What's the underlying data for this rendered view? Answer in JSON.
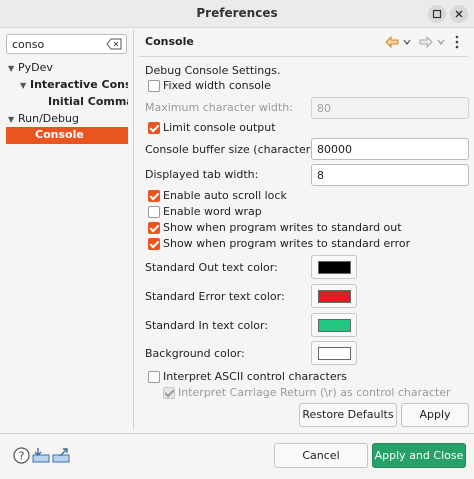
{
  "window": {
    "title": "Preferences"
  },
  "filter": {
    "value": "conso"
  },
  "tree": [
    {
      "label": "PyDev",
      "expanded": true
    },
    {
      "label": "Interactive Conso",
      "expanded": true
    },
    {
      "label": "Initial Comman"
    },
    {
      "label": "Run/Debug",
      "expanded": true
    },
    {
      "label": "Console",
      "selected": true
    }
  ],
  "page": {
    "title": "Console",
    "intro": "Debug Console Settings.",
    "fixed_width": {
      "label": "Fixed width console",
      "checked": false
    },
    "max_char_width": {
      "label": "Maximum character width:",
      "value": "80",
      "enabled": false
    },
    "limit_output": {
      "label": "Limit console output",
      "checked": true
    },
    "buffer_size": {
      "label": "Console buffer size (characters):",
      "value": "80000"
    },
    "tab_width": {
      "label": "Displayed tab width:",
      "value": "8"
    },
    "auto_scroll": {
      "label": "Enable auto scroll lock",
      "checked": true
    },
    "word_wrap": {
      "label": "Enable word wrap",
      "checked": false
    },
    "show_stdout": {
      "label": "Show when program writes to standard out",
      "checked": true
    },
    "show_stderr": {
      "label": "Show when program writes to standard error",
      "checked": true
    },
    "colors": [
      {
        "label": "Standard Out text color:",
        "color": "#000000"
      },
      {
        "label": "Standard Error text color:",
        "color": "#e01b24"
      },
      {
        "label": "Standard In text color:",
        "color": "#1fc77f"
      },
      {
        "label": "Background color:",
        "color": "#ffffff"
      }
    ],
    "interpret_ascii": {
      "label": "Interpret ASCII control characters",
      "checked": false
    },
    "interpret_cr": {
      "label": "Interpret Carriage Return (\\r) as control character",
      "checked": true,
      "enabled": false
    },
    "restore_defaults": "Restore Defaults",
    "apply": "Apply"
  },
  "footer": {
    "cancel": "Cancel",
    "apply_close": "Apply and Close"
  },
  "icons": {
    "help": "help-icon",
    "import": "import-icon",
    "export": "export-icon",
    "back": "back-arrow-icon",
    "forward": "forward-arrow-icon",
    "menu": "view-menu-icon"
  },
  "accent": "#e95420",
  "primary_button_color": "#26a269"
}
